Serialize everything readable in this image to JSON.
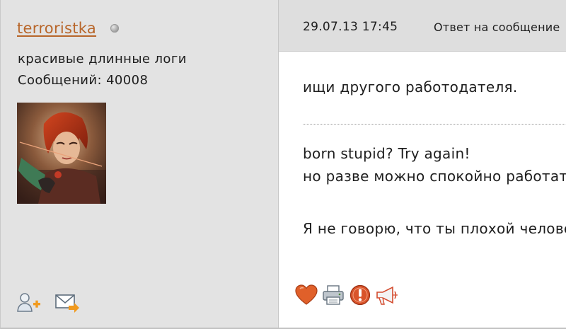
{
  "user": {
    "username": "terroristka",
    "status": "offline",
    "title": "красивые длинные логи",
    "post_count": "Сообщений: 40008",
    "avatar": "avatar-image",
    "actions": [
      {
        "icon": "add-friend-icon"
      },
      {
        "icon": "send-message-icon"
      }
    ]
  },
  "post": {
    "date": "29.07.13 17:45",
    "reply_label": "Ответ на сообщение",
    "text_lines": [
      "ищи другого работодателя."
    ],
    "signature_lines": [
      "born stupid? Try again!",
      "но разве можно спокойно работать...",
      "Я не говорю, что ты плохой человек..."
    ],
    "actions": [
      {
        "icon": "heart-icon"
      },
      {
        "icon": "print-icon"
      },
      {
        "icon": "report-icon"
      },
      {
        "icon": "megaphone-icon"
      }
    ]
  },
  "colors": {
    "username": "#b8662a",
    "panel_bg": "#e3e3e3",
    "header_bg": "#dedede",
    "heart": "#e0602a",
    "report": "#d9542b"
  }
}
